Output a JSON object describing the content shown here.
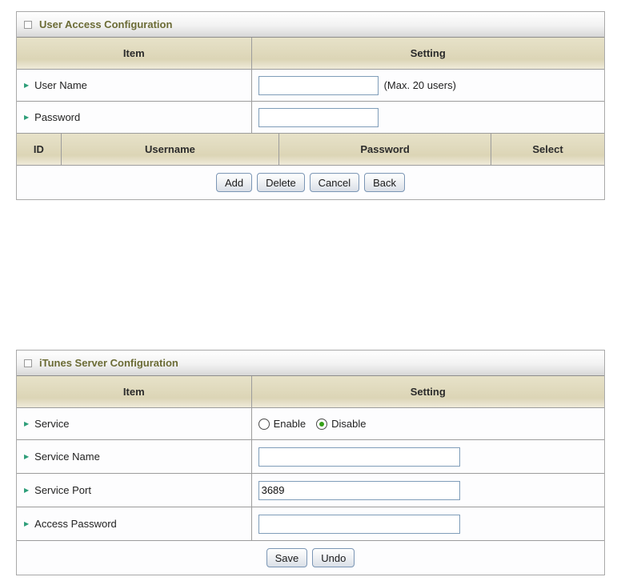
{
  "icons": {
    "arrow": "▶"
  },
  "user_access": {
    "title": "User Access Configuration",
    "columns": {
      "item": "Item",
      "setting": "Setting"
    },
    "username_row": {
      "label": "User Name",
      "value": "",
      "note": "(Max. 20 users)"
    },
    "password_row": {
      "label": "Password",
      "value": ""
    },
    "table_headers": [
      "ID",
      "Username",
      "Password",
      "Select"
    ],
    "buttons": [
      "Add",
      "Delete",
      "Cancel",
      "Back"
    ]
  },
  "itunes": {
    "title": "iTunes Server Configuration",
    "columns": {
      "item": "Item",
      "setting": "Setting"
    },
    "service_row": {
      "label": "Service",
      "options": [
        {
          "label": "Enable",
          "checked": false
        },
        {
          "label": "Disable",
          "checked": true
        }
      ],
      "selected": "Disable"
    },
    "service_name_row": {
      "label": "Service Name",
      "value": ""
    },
    "service_port_row": {
      "label": "Service Port",
      "value": "3689"
    },
    "access_password_row": {
      "label": "Access Password",
      "value": ""
    },
    "buttons": [
      "Save",
      "Undo"
    ]
  },
  "colors": {
    "title_text": "#6b6b35",
    "header_beige": "#dcd5b6",
    "arrow_green": "#2e9e79",
    "radio_selected_green": "#35a017",
    "input_border": "#7f9db9"
  }
}
